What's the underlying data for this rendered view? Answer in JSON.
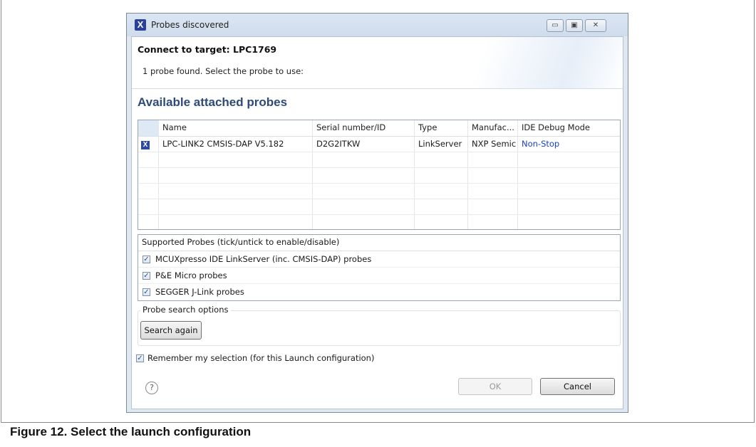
{
  "window": {
    "title": "Probes discovered",
    "app_icon_glyph": "X",
    "controls": [
      "minimize-icon",
      "maximize-icon",
      "close-icon"
    ]
  },
  "header": {
    "title": "Connect to target: LPC1769",
    "message": "1 probe found. Select the probe to use:"
  },
  "probes": {
    "section_title": "Available attached probes",
    "columns": [
      "Name",
      "Serial number/ID",
      "Type",
      "Manufac...",
      "IDE Debug Mode"
    ],
    "rows": [
      {
        "selected": true,
        "name": "LPC-LINK2 CMSIS-DAP V5.182",
        "serial": "D2G2ITKW",
        "type": "LinkServer",
        "manufacturer": "NXP Semic",
        "debug_mode": "Non-Stop"
      }
    ]
  },
  "supported": {
    "header": "Supported Probes (tick/untick to enable/disable)",
    "items": [
      {
        "label": "MCUXpresso IDE LinkServer (inc. CMSIS-DAP) probes",
        "checked": true
      },
      {
        "label": "P&E Micro probes",
        "checked": true
      },
      {
        "label": "SEGGER J-Link probes",
        "checked": true
      }
    ]
  },
  "search": {
    "legend": "Probe search options",
    "button_label": "Search again"
  },
  "remember": {
    "label": "Remember my selection (for this Launch configuration)",
    "checked": true
  },
  "footer": {
    "ok_label": "OK",
    "cancel_label": "Cancel",
    "help_glyph": "?"
  },
  "caption": "Figure 12.  Select the launch configuration",
  "colors": {
    "section_title": "#2d4a7a",
    "link": "#1a3fc8",
    "check_blue": "#2c4aa0"
  }
}
